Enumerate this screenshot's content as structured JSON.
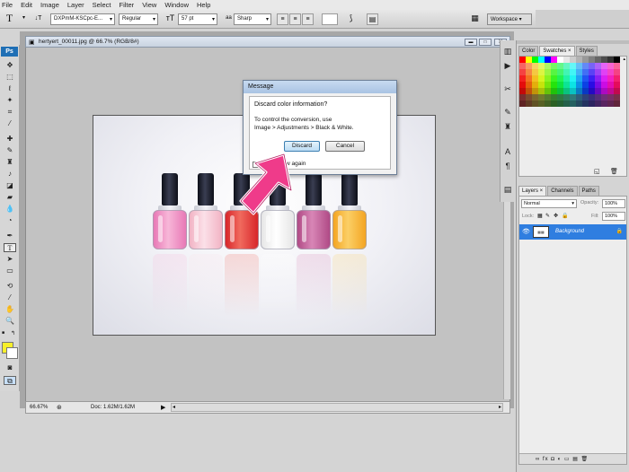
{
  "menu": [
    "File",
    "Edit",
    "Image",
    "Layer",
    "Select",
    "Filter",
    "View",
    "Window",
    "Help"
  ],
  "options_bar": {
    "font_family": "DXPmM-KSCpc-E...",
    "font_style": "Regular",
    "font_size": "57 pt",
    "antialias_prefix": "aa",
    "antialias": "Sharp",
    "workspace": "Workspace ▾"
  },
  "toolbar": {
    "logo": "Ps"
  },
  "document": {
    "title": "hertyert_00011.jpg @ 66.7% (RGB/8#)",
    "zoom": "66.67%",
    "doc_info": "Doc: 1.62M/1.62M"
  },
  "bottles": [
    {
      "color": "#e879b6",
      "light": "#f7b6d8"
    },
    {
      "color": "#f2b3c4",
      "light": "#fbe0e8"
    },
    {
      "color": "#d8262a",
      "light": "#f06a5e"
    },
    {
      "color": "#e6e6e6",
      "light": "#ffffff"
    },
    {
      "color": "#b04a86",
      "light": "#d886b6"
    },
    {
      "color": "#f4a522",
      "light": "#fbcf66"
    }
  ],
  "dialog": {
    "title": "Message",
    "question": "Discard color information?",
    "line1": "To control the conversion, use",
    "line2": "Image > Adjustments > Black & White.",
    "discard": "Discard",
    "cancel": "Cancel",
    "dont_show": "w again"
  },
  "swatch_panel": {
    "tabs": [
      "Color",
      "Swatches ×",
      "Styles"
    ]
  },
  "layers_panel": {
    "tabs": [
      "Layers ×",
      "Channels",
      "Paths"
    ],
    "blend_mode": "Normal",
    "opacity_label": "Opacity:",
    "opacity": "100%",
    "lock_label": "Lock:",
    "fill_label": "Fill:",
    "fill": "100%",
    "layer_name": "Background",
    "bottom_icons": "∞  fx  ◘  ◐  ▭  ▤  🗑"
  },
  "colors": {
    "foreground": "#f7ef2a",
    "background": "#ffffff",
    "selected_layer": "#2f7ee0"
  }
}
